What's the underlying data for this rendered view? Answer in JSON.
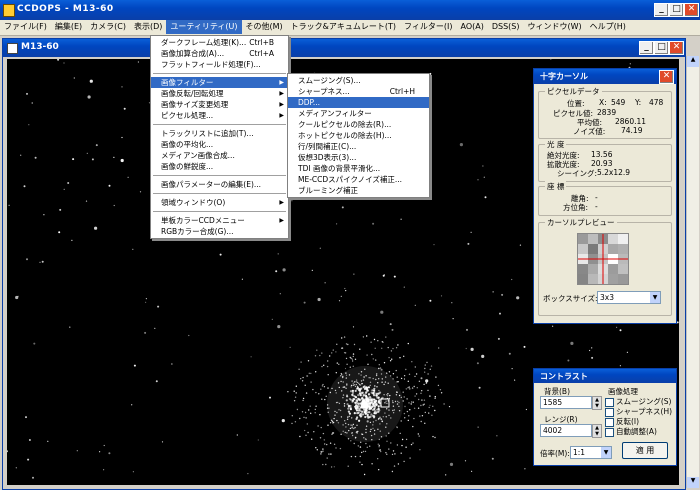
{
  "app": {
    "title": "CCDOPS - M13-60",
    "menu": [
      "ファイル(F)",
      "編集(E)",
      "カメラ(C)",
      "表示(D)",
      "ユーティリティ(U)",
      "その他(M)",
      "トラック&アキュムレート(T)",
      "フィルター(I)",
      "AO(A)",
      "DSS(S)",
      "ウィンドウ(W)",
      "ヘルプ(H)"
    ],
    "active_menu_index": 4
  },
  "image_window": {
    "title": "M13-60"
  },
  "utility_menu": {
    "items": [
      {
        "label": "ダークフレーム処理(K)...",
        "shortcut": "Ctrl+B"
      },
      {
        "label": "画像加算合成(A)...",
        "shortcut": "Ctrl+A"
      },
      {
        "label": "フラットフィールド処理(F)...",
        "shortcut": ""
      },
      {
        "sep": true
      },
      {
        "label": "画像フィルター",
        "submenu": true,
        "highlight": true
      },
      {
        "label": "画像反転/回転処理",
        "submenu": true
      },
      {
        "label": "画像サイズ変更処理",
        "submenu": true
      },
      {
        "label": "ピクセル処理...",
        "submenu": true
      },
      {
        "sep": true
      },
      {
        "label": "トラックリストに追加(T)...",
        "shortcut": ""
      },
      {
        "label": "画像の平均化...",
        "shortcut": ""
      },
      {
        "label": "メディアン画像合成...",
        "shortcut": ""
      },
      {
        "label": "画像の鮮鋭度...",
        "shortcut": ""
      },
      {
        "sep": true
      },
      {
        "label": "画像パラメーターの編集(E)...",
        "shortcut": ""
      },
      {
        "sep": true
      },
      {
        "label": "領域ウィンドウ(O)",
        "submenu": true
      },
      {
        "sep": true
      },
      {
        "label": "単板カラーCCDメニュー",
        "submenu": true
      },
      {
        "label": "RGBカラー合成(G)...",
        "shortcut": ""
      }
    ]
  },
  "filter_submenu": {
    "items": [
      {
        "label": "スムージング(S)...",
        "shortcut": ""
      },
      {
        "label": "シャープネス...",
        "shortcut": "Ctrl+H"
      },
      {
        "label": "DDP...",
        "shortcut": "",
        "highlight": true
      },
      {
        "label": "メディアンフィルター",
        "shortcut": ""
      },
      {
        "label": "クールピクセルの除去(R)...",
        "shortcut": ""
      },
      {
        "label": "ホットピクセルの除去(H)...",
        "shortcut": ""
      },
      {
        "label": "行/列間補正(C)...",
        "shortcut": ""
      },
      {
        "label": "仮想3D表示(3)...",
        "shortcut": ""
      },
      {
        "label": "TDI 画像の背景平滑化...",
        "shortcut": ""
      },
      {
        "label": "ME-CCDスパイクノイズ補正...",
        "shortcut": ""
      },
      {
        "label": "ブルーミング補正",
        "shortcut": ""
      }
    ]
  },
  "crosshair": {
    "title": "十字カーソル",
    "pixel_data_title": "ピクセルデータ",
    "position_label": "位置:",
    "x_label": "X:",
    "x": "549",
    "y_label": "Y:",
    "y": "478",
    "pixel_value_label": "ピクセル値:",
    "pixel_value": "2839",
    "mean_label": "平均値:",
    "mean": "2860.11",
    "noise_label": "ノイズ値:",
    "noise": "74.19",
    "brightness_title": "光 度",
    "abs_brightness_label": "絶対光度:",
    "abs_brightness": "13.56",
    "diff_brightness_label": "拡散光度:",
    "diff_brightness": "20.93",
    "seeing_label": "シーイング:",
    "seeing": "5.2x12.9",
    "coords_title": "座 標",
    "dec_label": "離角:",
    "dec": "-",
    "pa_label": "方位角:",
    "pa": "-",
    "preview_title": "カーソルプレビュー",
    "box_size_label": "ボックスサイズ:",
    "box_size": "3x3"
  },
  "contrast": {
    "title": "コントラスト",
    "background_label": "背景(B)",
    "background": "1585",
    "range_label": "レンジ(R)",
    "range": "4002",
    "processing_title": "画像処理",
    "smoothing": "スムージング(S)",
    "sharpness": "シャープネス(H)",
    "invert": "反転(I)",
    "auto": "自動調整(A)",
    "zoom_label": "倍率(M):",
    "zoom": "1:1",
    "apply": "適 用"
  },
  "colors": {
    "accent": "#316ac5",
    "titlebar": "#0046c0",
    "panel": "#ece9d8",
    "image_bg": "#000000"
  }
}
